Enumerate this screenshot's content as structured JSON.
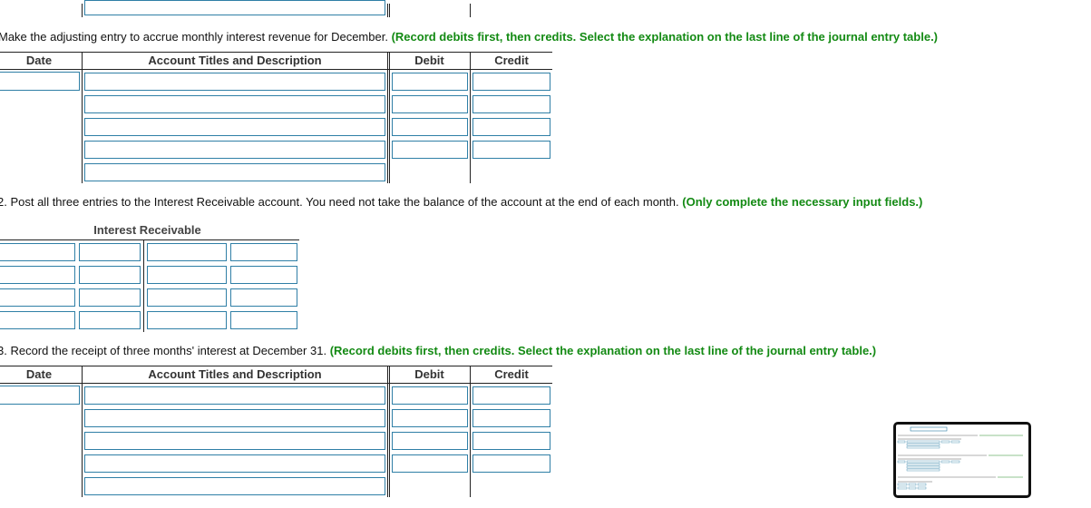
{
  "colors": {
    "hint": "#138a13",
    "input_border": "#2f7fa6",
    "rule": "#222222"
  },
  "section_c": {
    "instruction": "Make the adjusting entry to accrue monthly interest revenue for December.",
    "hint": "(Record debits first, then credits. Select the explanation on the last line of the journal entry table.)",
    "headers": {
      "date": "Date",
      "account": "Account Titles and Description",
      "debit": "Debit",
      "credit": "Credit"
    }
  },
  "section_2": {
    "instruction": "2. Post all three entries to the Interest Receivable account. You need not take the balance of the account at the end of each month.",
    "hint": "(Only complete the necessary input fields.)",
    "t_account_title": "Interest Receivable"
  },
  "section_3": {
    "instruction": "3. Record the receipt of three months' interest at December 31.",
    "hint": "(Record debits first, then credits. Select the explanation on the last line of the journal entry table.)",
    "headers": {
      "date": "Date",
      "account": "Account Titles and Description",
      "debit": "Debit",
      "credit": "Credit"
    }
  },
  "thumbnail": {
    "icon": "page-preview-icon"
  }
}
